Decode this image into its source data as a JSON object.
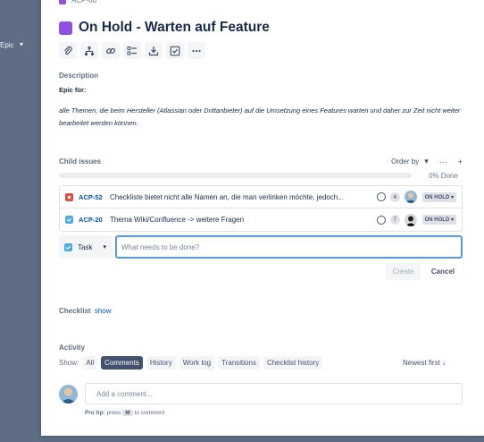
{
  "background": {
    "epic_label": "Epic"
  },
  "issue": {
    "key": "ACP-60",
    "status_title": "On Hold - Warten auf Feature",
    "epic_color": "#904ee2"
  },
  "toolbar": {
    "icons": [
      "attach-icon",
      "child-issue-icon",
      "link-icon",
      "checklist-template-icon",
      "download-icon",
      "checkbox-icon",
      "more-icon"
    ]
  },
  "description": {
    "label": "Description",
    "bold": "Epic für:",
    "text": "alle Themen, die beim Hersteller (Atlassian oder Drittanbieter) auf die Umsetzung eines Features warten und daher zur Zeit nicht weiter bearbeitet werden können."
  },
  "child_issues": {
    "label": "Child issues",
    "order_by": "Order by",
    "progress_text": "0% Done",
    "progress_fraction": 0,
    "items": [
      {
        "type": "bug",
        "key": "ACP-52",
        "summary": "Checkliste bietet nicht alle Namen an, die man verlinken möchte, jedoch...",
        "count": "4",
        "status": "ON HOLD"
      },
      {
        "type": "task",
        "key": "ACP-20",
        "summary": "Thema Wiki/Confluence -> weitere Fragen",
        "count": "7",
        "status": "ON HOLD"
      }
    ]
  },
  "create": {
    "type_label": "Task",
    "placeholder": "What needs to be done?",
    "create_label": "Create",
    "cancel_label": "Cancel"
  },
  "checklist": {
    "label": "Checklist",
    "show": "show"
  },
  "activity": {
    "label": "Activity",
    "show_label": "Show:",
    "filters": [
      "All",
      "Comments",
      "History",
      "Work log",
      "Transitions",
      "Checklist history"
    ],
    "active_filter": "Comments",
    "sort": "Newest first ↓",
    "comment_placeholder": "Add a comment...",
    "protip_prefix": "Pro tip:",
    "protip_press": "press",
    "protip_key": "M",
    "protip_suffix": "to comment"
  }
}
